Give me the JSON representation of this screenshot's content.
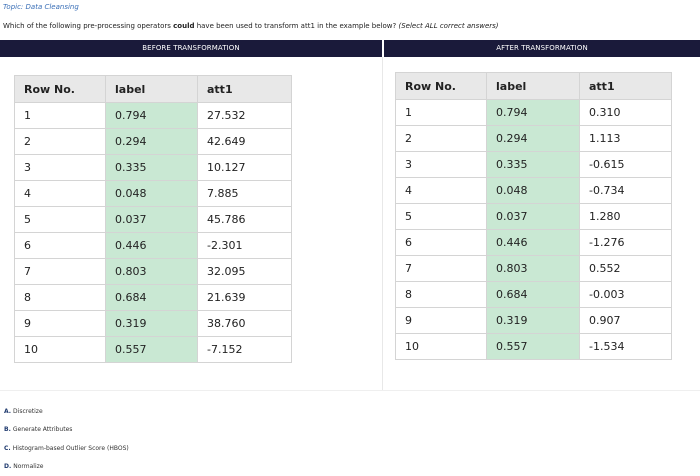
{
  "topic": "Topic: Data Cleansing",
  "question": {
    "part1": "Which of the following pre-processing operators ",
    "bold": "could",
    "part2": " have been used to transform att1 in the example below? ",
    "italic": "(Select ALL correct answers)"
  },
  "before": {
    "header": "BEFORE TRANSFORMATION",
    "columns": [
      "Row No.",
      "label",
      "att1"
    ],
    "rows": [
      [
        "1",
        "0.794",
        "27.532"
      ],
      [
        "2",
        "0.294",
        "42.649"
      ],
      [
        "3",
        "0.335",
        "10.127"
      ],
      [
        "4",
        "0.048",
        "7.885"
      ],
      [
        "5",
        "0.037",
        "45.786"
      ],
      [
        "6",
        "0.446",
        "-2.301"
      ],
      [
        "7",
        "0.803",
        "32.095"
      ],
      [
        "8",
        "0.684",
        "21.639"
      ],
      [
        "9",
        "0.319",
        "38.760"
      ],
      [
        "10",
        "0.557",
        "-7.152"
      ]
    ]
  },
  "after": {
    "header": "AFTER TRANSFORMATION",
    "columns": [
      "Row No.",
      "label",
      "att1"
    ],
    "rows": [
      [
        "1",
        "0.794",
        "0.310"
      ],
      [
        "2",
        "0.294",
        "1.113"
      ],
      [
        "3",
        "0.335",
        "-0.615"
      ],
      [
        "4",
        "0.048",
        "-0.734"
      ],
      [
        "5",
        "0.037",
        "1.280"
      ],
      [
        "6",
        "0.446",
        "-1.276"
      ],
      [
        "7",
        "0.803",
        "0.552"
      ],
      [
        "8",
        "0.684",
        "-0.003"
      ],
      [
        "9",
        "0.319",
        "0.907"
      ],
      [
        "10",
        "0.557",
        "-1.534"
      ]
    ]
  },
  "answers": [
    {
      "letter": "A.",
      "text": "Discretize"
    },
    {
      "letter": "B.",
      "text": "Generate Attributes"
    },
    {
      "letter": "C.",
      "text": "Histogram-based Outlier Score (HBOS)"
    },
    {
      "letter": "D.",
      "text": "Normalize"
    }
  ],
  "colors": {
    "header_band": "#1a1a3a",
    "label_highlight": "#c9e8d3",
    "topic_link": "#3a6fb7"
  }
}
